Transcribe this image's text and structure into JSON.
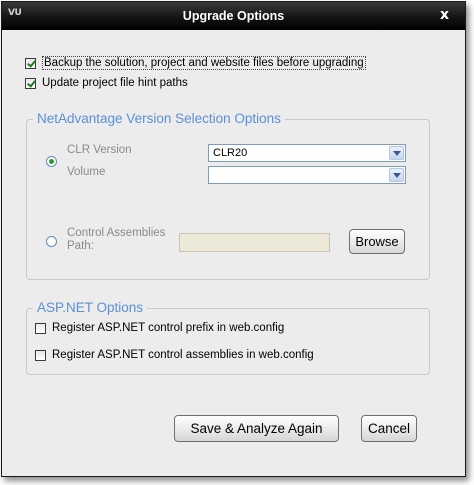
{
  "window": {
    "logo": "VU",
    "title": "Upgrade Options",
    "close_glyph": "x"
  },
  "options": {
    "backup": {
      "label": "Backup the solution, project and website files before upgrading",
      "checked": true
    },
    "update_hints": {
      "label": "Update project file hint paths",
      "checked": true
    }
  },
  "version_group": {
    "legend": "NetAdvantage Version Selection Options",
    "clr_radio_selected": true,
    "clr_version_label": "CLR Version",
    "clr_version_value": "CLR20",
    "volume_label": "Volume",
    "volume_value": "",
    "control_assemblies_label_line1": "Control Assemblies",
    "control_assemblies_label_line2": "Path:",
    "control_assemblies_path": "",
    "browse_label": "Browse"
  },
  "aspnet_group": {
    "legend": "ASP.NET Options",
    "register_prefix": {
      "label": "Register ASP.NET control prefix in web.config",
      "checked": false
    },
    "register_assemblies": {
      "label": "Register ASP.NET control assemblies in web.config",
      "checked": false
    }
  },
  "footer": {
    "save_label": "Save & Analyze Again",
    "cancel_label": "Cancel"
  },
  "colors": {
    "legend_accent": "#5b8fd6",
    "titlebar": "#141414",
    "check_mark": "#1e7d1e"
  }
}
